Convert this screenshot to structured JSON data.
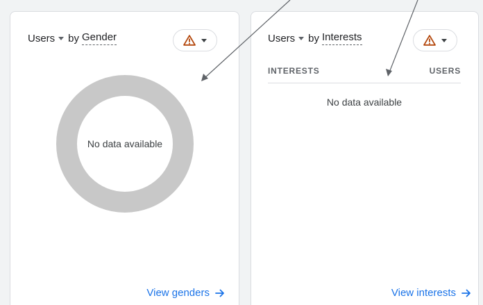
{
  "cards": [
    {
      "metric_label": "Users",
      "dimension_prefix": "by",
      "dimension_label": "Gender",
      "empty_message": "No data available",
      "link_label": "View genders",
      "link_arrow": "→",
      "donut_color": "#c8c8c8"
    },
    {
      "metric_label": "Users",
      "dimension_prefix": "by",
      "dimension_label": "Interests",
      "table_columns": [
        "INTERESTS",
        "USERS"
      ],
      "empty_message": "No data available",
      "link_label": "View interests",
      "link_arrow": "→"
    }
  ],
  "icons": {
    "warning": "warning-triangle-icon",
    "dropdown": "caret-down-icon",
    "link": "arrow-right-icon"
  },
  "colors": {
    "warning": "#b3470c",
    "link": "#1a73e8",
    "donut": "#c8c8c8",
    "annotation_arrow": "#5f6368"
  }
}
